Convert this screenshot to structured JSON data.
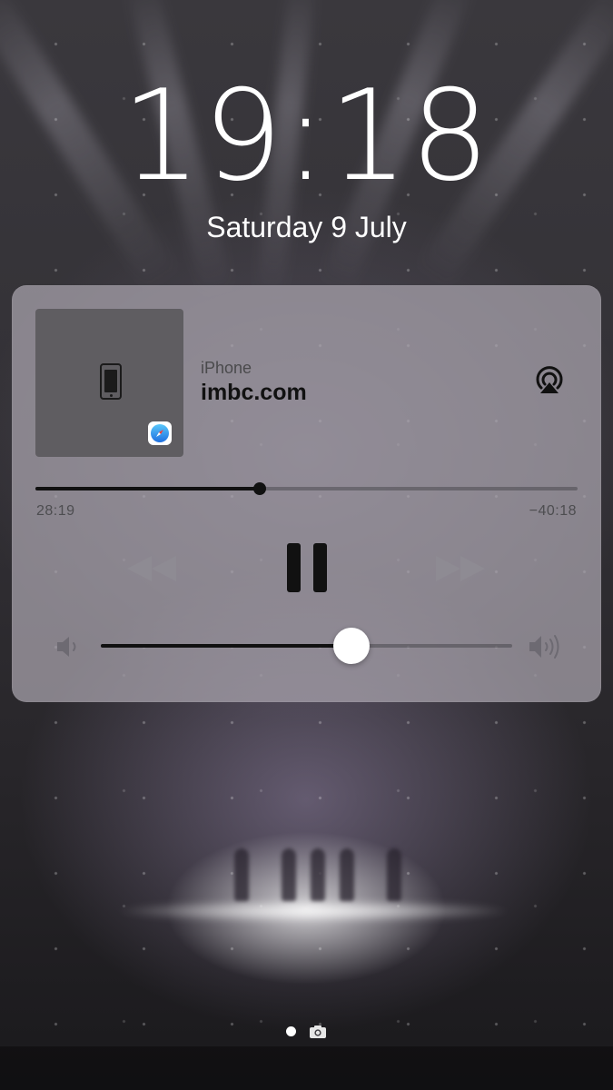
{
  "lock_screen": {
    "time": "19:18",
    "date": "Saturday 9 July"
  },
  "now_playing": {
    "source": "iPhone",
    "title": "imbc.com",
    "elapsed": "28:19",
    "remaining": "−40:18",
    "progress_fraction": 0.413,
    "volume_fraction": 0.61,
    "state": "playing",
    "artwork_icon": "iphone-icon",
    "app_badge_icon": "safari-icon",
    "airplay_icon": "airplay-icon"
  },
  "colors": {
    "player_background": "#aaa5af",
    "control_dark": "#111111",
    "control_disabled": "#8e8b93"
  }
}
